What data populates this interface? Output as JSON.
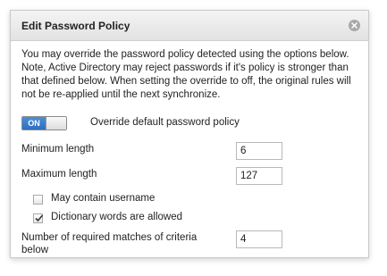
{
  "dialog": {
    "title": "Edit Password Policy",
    "description": "You may override the password policy detected using the options below. Note, Active Directory may reject passwords if it's policy is stronger than that defined below. When setting the override to off, the original rules will not be re-applied until the next synchronize."
  },
  "override": {
    "toggle_label": "ON",
    "checked": true,
    "label": "Override default password policy"
  },
  "fields": {
    "min_length": {
      "label": "Minimum length",
      "value": "6"
    },
    "max_length": {
      "label": "Maximum length",
      "value": "127"
    },
    "required_matches": {
      "label": "Number of required matches of criteria below",
      "value": "4"
    }
  },
  "checkboxes": {
    "may_contain_username": {
      "label": "May contain username",
      "checked": false
    },
    "dictionary_words": {
      "label": "Dictionary words are allowed",
      "checked": true
    }
  },
  "colors": {
    "accent": "#3a7fcf",
    "title_bg": "#e8e8e8"
  },
  "icons": {
    "close": "close-icon",
    "check": "checkmark-icon"
  }
}
